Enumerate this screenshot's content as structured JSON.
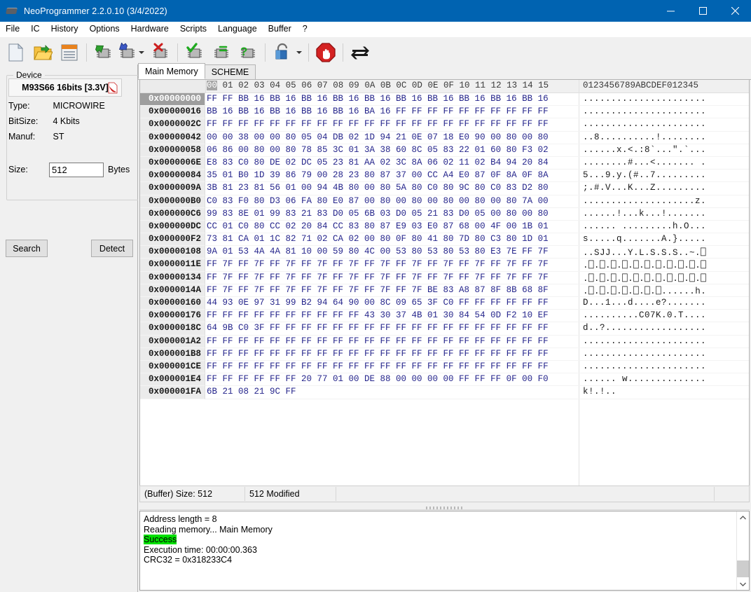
{
  "window": {
    "title": "NeoProgrammer 2.2.0.10 (3/4/2022)",
    "app_icon": "chip-icon",
    "minimize": "─",
    "maximize": "☐",
    "close": "✕"
  },
  "menu": {
    "items": [
      {
        "label": "File"
      },
      {
        "label": "IC"
      },
      {
        "label": "History"
      },
      {
        "label": "Options"
      },
      {
        "label": "Hardware"
      },
      {
        "label": "Scripts"
      },
      {
        "label": "Language"
      },
      {
        "label": "Buffer"
      },
      {
        "label": "?"
      }
    ]
  },
  "toolbar": {
    "buttons": [
      {
        "name": "new-file-icon",
        "title": "New"
      },
      {
        "name": "open-folder-icon",
        "title": "Open"
      },
      {
        "name": "save-floppy-icon",
        "title": "Save"
      },
      {
        "name": "read-chip-icon",
        "title": "Read"
      },
      {
        "name": "write-chip-icon",
        "title": "Write"
      },
      {
        "name": "erase-chip-icon",
        "title": "Erase"
      },
      {
        "name": "verify-chip-icon",
        "title": "Verify"
      },
      {
        "name": "blank-check-chip-icon",
        "title": "Blank check"
      },
      {
        "name": "chip-info-icon",
        "title": "Chip info"
      },
      {
        "name": "lock-protect-icon",
        "title": "Protect"
      },
      {
        "name": "stop-icon",
        "title": "Stop"
      },
      {
        "name": "refresh-icon",
        "title": "Refresh"
      }
    ]
  },
  "device": {
    "group_label": "Device",
    "name": "M93S66 16bits [3.3V]",
    "pdf_icon": "pdf-icon",
    "type_label": "Type:",
    "type_value": "MICROWIRE",
    "bitsize_label": "BitSize:",
    "bitsize_value": "4 Kbits",
    "manuf_label": "Manuf:",
    "manuf_value": "ST",
    "size_label": "Size:",
    "size_value": "512",
    "size_unit": "Bytes",
    "search_button": "Search",
    "detect_button": "Detect"
  },
  "tabs": [
    {
      "label": "Main Memory",
      "active": true
    },
    {
      "label": "SCHEME",
      "active": false
    }
  ],
  "hex": {
    "column_headers": [
      "00",
      "01",
      "02",
      "03",
      "04",
      "05",
      "06",
      "07",
      "08",
      "09",
      "0A",
      "0B",
      "0C",
      "0D",
      "0E",
      "0F",
      "10",
      "11",
      "12",
      "13",
      "14",
      "15"
    ],
    "ascii_header": "0123456789ABCDEF012345",
    "selected_column": "00",
    "bytes_per_row": 22,
    "rows": [
      {
        "addr": "0x00000000",
        "bytes": "FF FF BB 16 BB 16 BB 16 BB 16 BB 16 BB 16 BB 16 BB 16 BB 16 BB 16",
        "ascii": "......................"
      },
      {
        "addr": "0x00000016",
        "bytes": "BB 16 BB 16 BB 16 BB 16 BB 16 BA 16 FF FF FF FF FF FF FF FF FF FF",
        "ascii": "......................"
      },
      {
        "addr": "0x0000002C",
        "bytes": "FF FF FF FF FF FF FF FF FF FF FF FF FF FF FF FF FF FF FF FF FF FF",
        "ascii": "......................"
      },
      {
        "addr": "0x00000042",
        "bytes": "00 00 38 00 00 80 05 04 DB 02 1D 94 21 0E 07 18 E0 90 00 80 00 80",
        "ascii": "..8..........!........"
      },
      {
        "addr": "0x00000058",
        "bytes": "06 86 00 80 00 80 78 85 3C 01 3A 38 60 8C 05 83 22 01 60 80 F3 02",
        "ascii": "......x.<.:8`...\".`..."
      },
      {
        "addr": "0x0000006E",
        "bytes": "E8 83 C0 80 DE 02 DC 05 23 81 AA 02 3C 8A 06 02 11 02 B4 94 20 84",
        "ascii": "........#...<....... ."
      },
      {
        "addr": "0x00000084",
        "bytes": "35 01 B0 1D 39 86 79 00 28 23 80 87 37 00 CC A4 E0 87 0F 8A 0F 8A",
        "ascii": "5...9.y.(#..7........."
      },
      {
        "addr": "0x0000009A",
        "bytes": "3B 81 23 81 56 01 00 94 4B 80 00 80 5A 80 C0 80 9C 80 C0 83 D2 80",
        "ascii": ";.#.V...K...Z........."
      },
      {
        "addr": "0x000000B0",
        "bytes": "C0 83 F0 80 D3 06 FA 80 E0 87 00 80 00 80 00 80 00 80 00 80 7A 00",
        "ascii": "....................z."
      },
      {
        "addr": "0x000000C6",
        "bytes": "99 83 8E 01 99 83 21 83 D0 05 6B 03 D0 05 21 83 D0 05 00 80 00 80",
        "ascii": "......!...k...!......."
      },
      {
        "addr": "0x000000DC",
        "bytes": "CC 01 C0 80 CC 02 20 84 CC 83 80 87 E9 03 E0 87 68 00 4F 00 1B 01",
        "ascii": "...... .........h.O..."
      },
      {
        "addr": "0x000000F2",
        "bytes": "73 81 CA 01 1C 82 71 02 CA 02 00 80 0F 80 41 80 7D 80 C3 80 1D 01",
        "ascii": "s.....q.......A.}....."
      },
      {
        "addr": "0x00000108",
        "bytes": "9A 01 53 4A 4A 81 10 00 59 80 4C 00 53 80 53 80 53 80 E3 7E FF 7F",
        "ascii": "..SJJ...Y.L.S.S.S..~.⎕"
      },
      {
        "addr": "0x0000011E",
        "bytes": "FF 7F FF 7F FF 7F FF 7F FF 7F FF 7F FF 7F FF 7F FF 7F FF 7F FF 7F",
        "ascii": ".⎕.⎕.⎕.⎕.⎕.⎕.⎕.⎕.⎕.⎕.⎕"
      },
      {
        "addr": "0x00000134",
        "bytes": "FF 7F FF 7F FF 7F FF 7F FF 7F FF 7F FF 7F FF 7F FF 7F FF 7F FF 7F",
        "ascii": ".⎕.⎕.⎕.⎕.⎕.⎕.⎕.⎕.⎕.⎕.⎕"
      },
      {
        "addr": "0x0000014A",
        "bytes": "FF 7F FF 7F FF 7F FF 7F FF 7F FF 7F FF 7F BE 83 A8 87 8F 8B 68 8F",
        "ascii": ".⎕.⎕.⎕.⎕.⎕.⎕.⎕......h."
      },
      {
        "addr": "0x00000160",
        "bytes": "44 93 0E 97 31 99 B2 94 64 90 00 8C 09 65 3F C0 FF FF FF FF FF FF",
        "ascii": "D...1...d....e?......."
      },
      {
        "addr": "0x00000176",
        "bytes": "FF FF FF FF FF FF FF FF FF FF 43 30 37 4B 01 30 84 54 0D F2 10 EF",
        "ascii": "..........C07K.0.T...."
      },
      {
        "addr": "0x0000018C",
        "bytes": "64 9B C0 3F FF FF FF FF FF FF FF FF FF FF FF FF FF FF FF FF FF FF",
        "ascii": "d..?.................."
      },
      {
        "addr": "0x000001A2",
        "bytes": "FF FF FF FF FF FF FF FF FF FF FF FF FF FF FF FF FF FF FF FF FF FF",
        "ascii": "......................"
      },
      {
        "addr": "0x000001B8",
        "bytes": "FF FF FF FF FF FF FF FF FF FF FF FF FF FF FF FF FF FF FF FF FF FF",
        "ascii": "......................"
      },
      {
        "addr": "0x000001CE",
        "bytes": "FF FF FF FF FF FF FF FF FF FF FF FF FF FF FF FF FF FF FF FF FF FF",
        "ascii": "......................"
      },
      {
        "addr": "0x000001E4",
        "bytes": "FF FF FF FF FF FF 20 77 01 00 DE 88 00 00 00 00 FF FF FF 0F 00 F0",
        "ascii": "...... w.............."
      },
      {
        "addr": "0x000001FA",
        "bytes": "6B 21 08 21 9C FF",
        "ascii": "k!.!.."
      }
    ]
  },
  "statusbar": {
    "buffer_size": "(Buffer) Size: 512",
    "modified": "512 Modified",
    "extra": ""
  },
  "log": {
    "lines": [
      {
        "text": "Address length = 8",
        "highlight": false
      },
      {
        "text": "Reading memory... Main Memory",
        "highlight": false
      },
      {
        "text": "Success",
        "highlight": true
      },
      {
        "text": "Execution time: 00:00:00.363",
        "highlight": false
      },
      {
        "text": "CRC32 = 0x318233C4",
        "highlight": false
      }
    ],
    "scroll_up_icon": "chevron-up-icon",
    "scroll_down_icon": "chevron-down-icon"
  },
  "colors": {
    "title_bar": "#0063b1",
    "hex_text": "#26268c",
    "success_highlight": "#00e000",
    "selection": "#9e9e9e"
  }
}
